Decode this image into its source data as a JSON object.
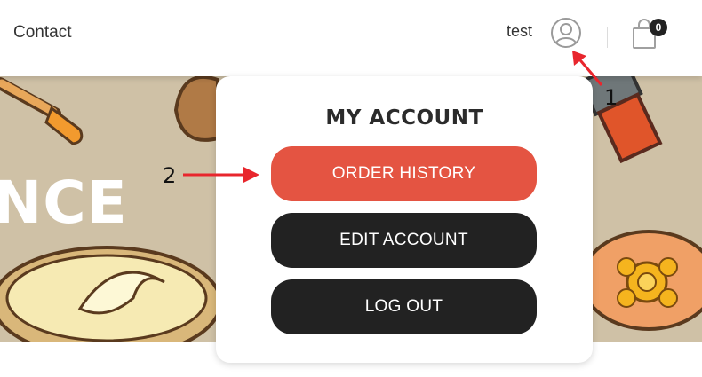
{
  "header": {
    "nav_contact": "Contact",
    "username": "test",
    "cart_count": "0"
  },
  "banner": {
    "text": "NCE"
  },
  "dropdown": {
    "title": "MY ACCOUNT",
    "items": [
      {
        "label": "ORDER HISTORY"
      },
      {
        "label": "EDIT ACCOUNT"
      },
      {
        "label": "LOG OUT"
      }
    ]
  },
  "annotations": {
    "marker_1": "1",
    "marker_2": "2",
    "color": "#e8262d"
  },
  "colors": {
    "accent": "#e45442",
    "dark_button": "#222222",
    "banner_bg": "#cfc1a6"
  }
}
